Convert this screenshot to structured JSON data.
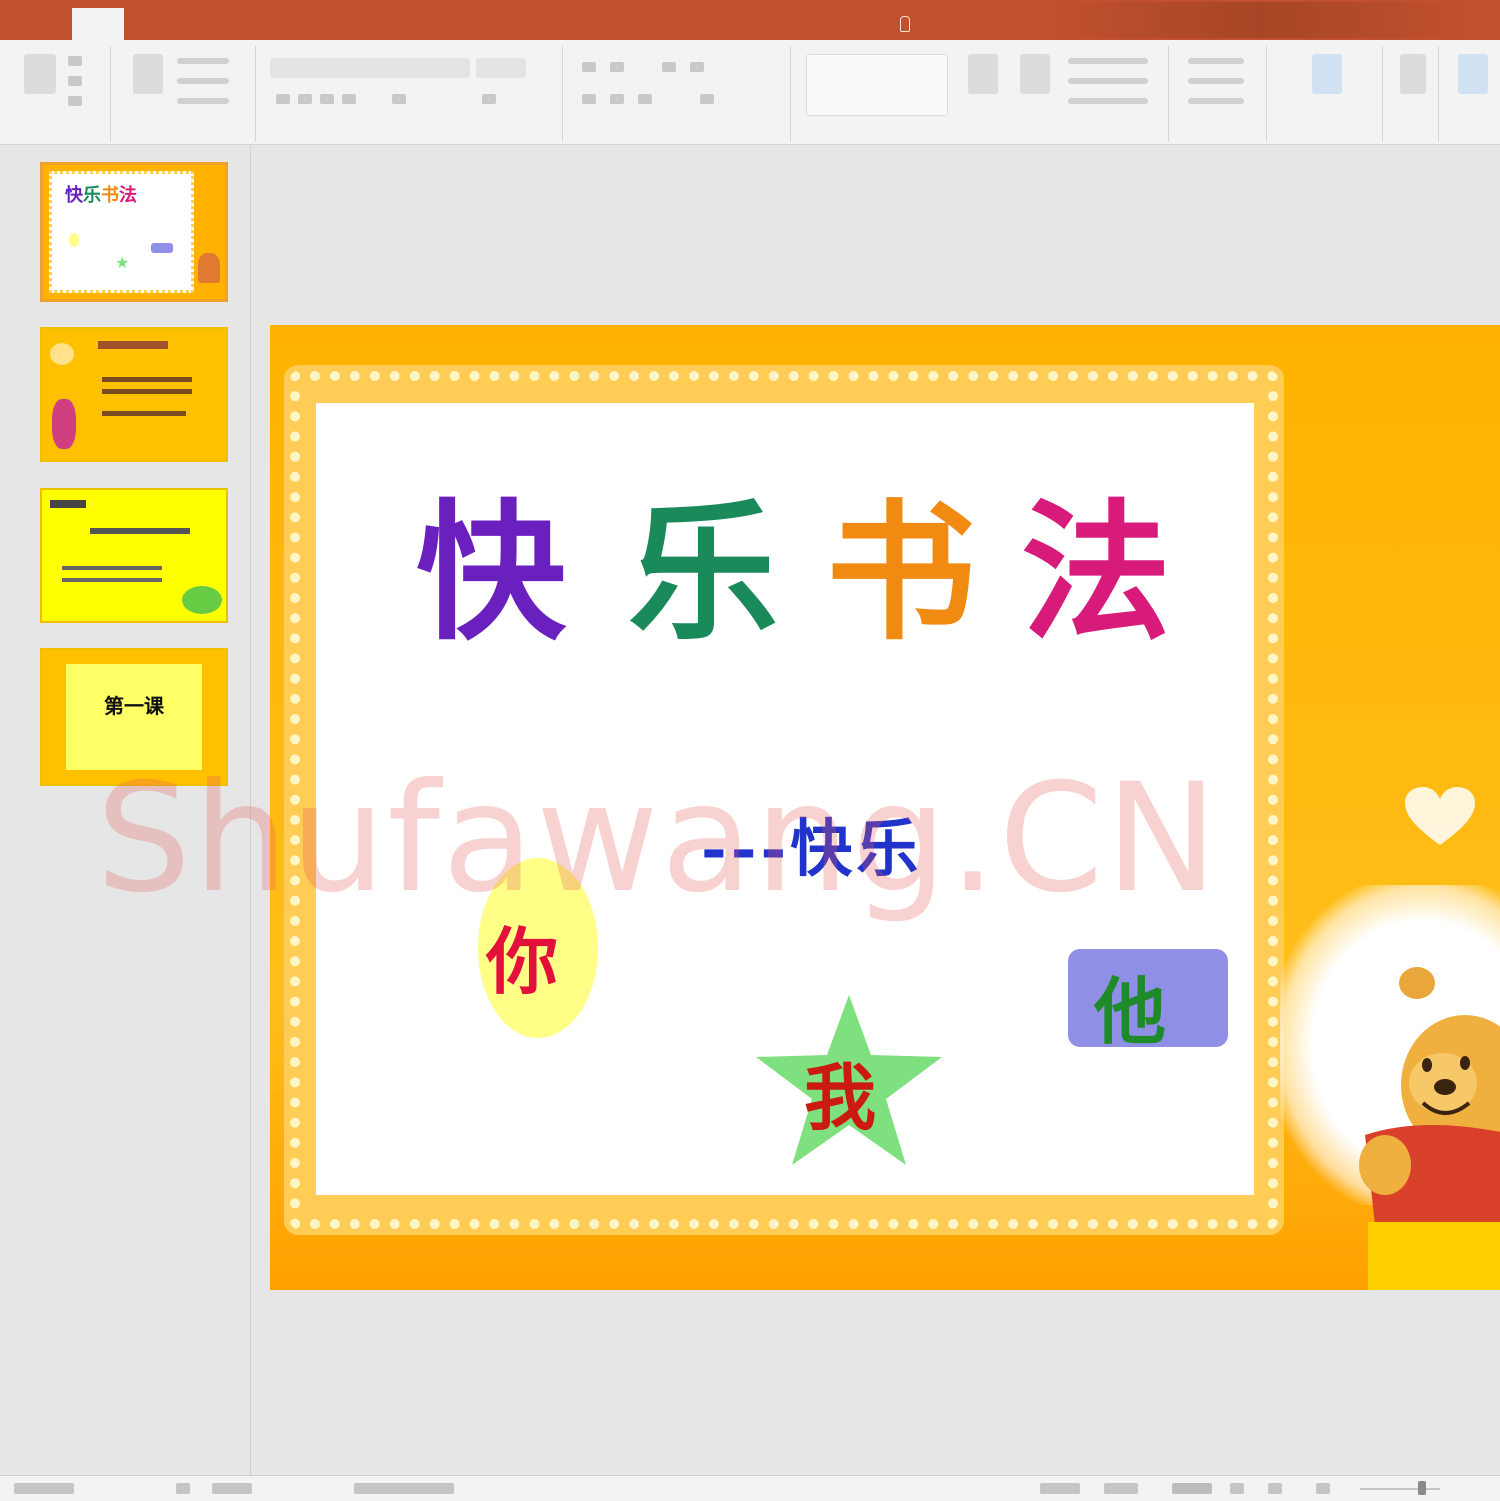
{
  "tabs": [],
  "slide": {
    "title_chars": [
      {
        "char": "快",
        "color": "#6a1fbf"
      },
      {
        "char": "乐",
        "color": "#1b8a5a"
      },
      {
        "char": "书",
        "color": "#f08a10"
      },
      {
        "char": "法",
        "color": "#d81b7a"
      }
    ],
    "subtitle": "---快乐",
    "you": "你",
    "he": "他",
    "me": "我"
  },
  "thumbnails": {
    "slide4_text": "第一课"
  },
  "watermark": "Shufawang.CN"
}
